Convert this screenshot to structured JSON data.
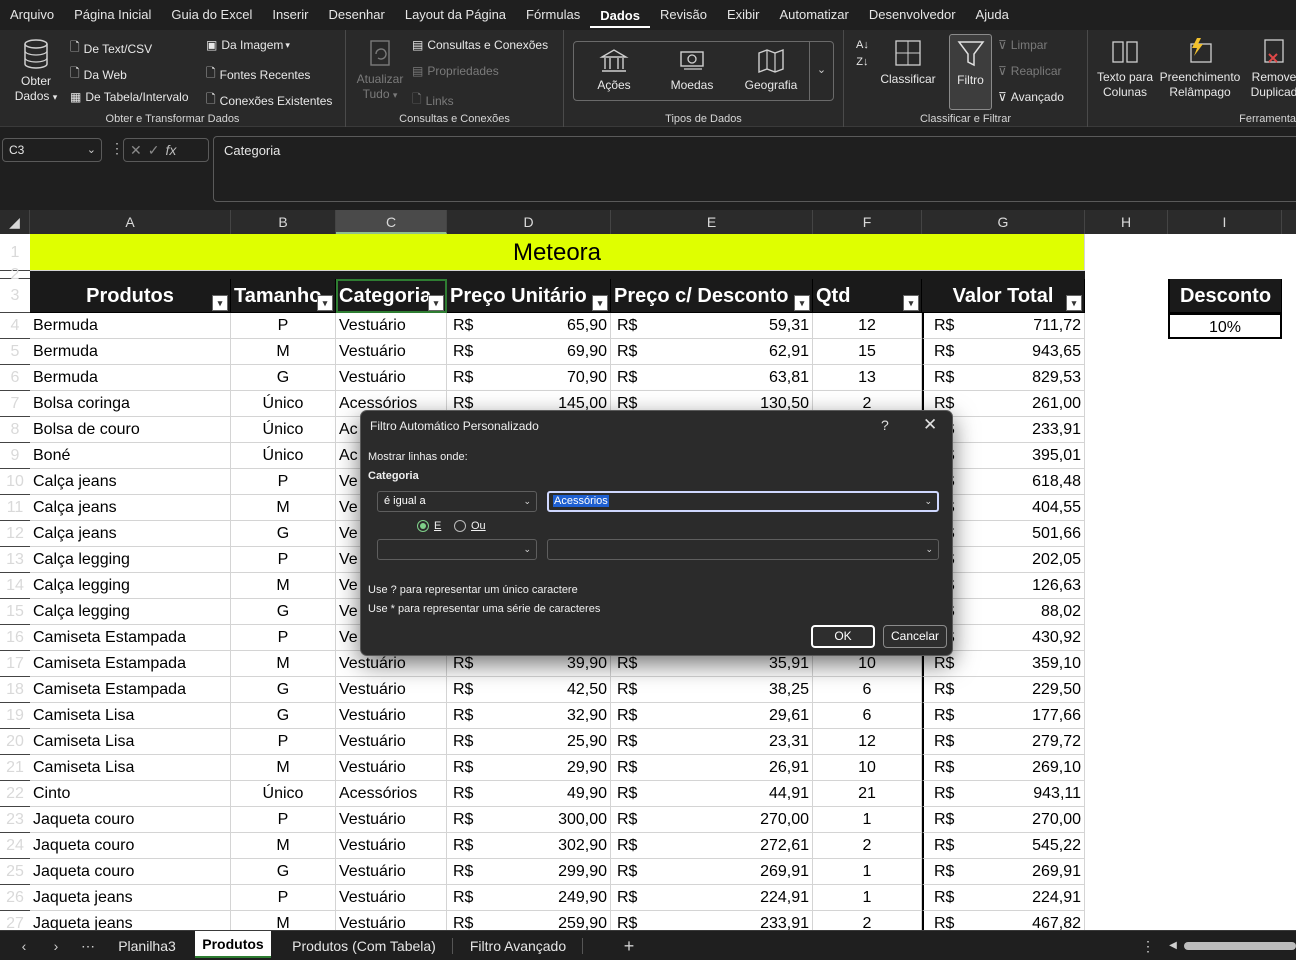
{
  "menu": [
    "Arquivo",
    "Página Inicial",
    "Guia do Excel",
    "Inserir",
    "Desenhar",
    "Layout da Página",
    "Fórmulas",
    "Dados",
    "Revisão",
    "Exibir",
    "Automatizar",
    "Desenvolvedor",
    "Ajuda"
  ],
  "active_menu": "Dados",
  "ribbon": {
    "obter": {
      "big_label_1": "Obter",
      "big_label_2": "Dados",
      "items": [
        "De Text/CSV",
        "Da Web",
        "De Tabela/Intervalo",
        "Da Imagem",
        "Fontes Recentes",
        "Conexões Existentes"
      ],
      "group_label": "Obter e Transformar Dados"
    },
    "consultas": {
      "big_label_1": "Atualizar",
      "big_label_2": "Tudo",
      "items": [
        "Consultas e Conexões",
        "Propriedades",
        "Links"
      ],
      "group_label": "Consultas e Conexões"
    },
    "tipos": {
      "items": [
        "Ações",
        "Moedas",
        "Geografia"
      ],
      "group_label": "Tipos de Dados"
    },
    "classificar": {
      "classificar_label": "Classificar",
      "filtro_label": "Filtro",
      "items": [
        "Limpar",
        "Reaplicar",
        "Avançado"
      ],
      "group_label": "Classificar e Filtrar"
    },
    "ferramentas": {
      "texto_1": "Texto para",
      "texto_2": "Colunas",
      "preench_1": "Preenchimento",
      "preench_2": "Relâmpago",
      "remove_1": "Remove",
      "remove_2": "Duplicad",
      "group_label": "Ferramenta"
    }
  },
  "formula_bar": {
    "name_box": "C3",
    "fx": "fx",
    "content": "Categoria"
  },
  "columns": [
    "A",
    "B",
    "C",
    "D",
    "E",
    "F",
    "G",
    "H",
    "I"
  ],
  "sheet": {
    "title": "Meteora",
    "headers": [
      "Produtos",
      "Tamanho",
      "Categoria",
      "Preço Unitário",
      "Preço c/ Desconto",
      "Qtd",
      "Valor Total"
    ],
    "desconto_label": "Desconto",
    "desconto_value": "10%",
    "currency": "R$",
    "rows": [
      {
        "n": "4",
        "a": "Bermuda",
        "b": "P",
        "c": "Vestuário",
        "d": "65,90",
        "e": "59,31",
        "f": "12",
        "g": "711,72"
      },
      {
        "n": "5",
        "a": "Bermuda",
        "b": "M",
        "c": "Vestuário",
        "d": "69,90",
        "e": "62,91",
        "f": "15",
        "g": "943,65"
      },
      {
        "n": "6",
        "a": "Bermuda",
        "b": "G",
        "c": "Vestuário",
        "d": "70,90",
        "e": "63,81",
        "f": "13",
        "g": "829,53"
      },
      {
        "n": "7",
        "a": "Bolsa coringa",
        "b": "Único",
        "c": "Acessórios",
        "d": "145,00",
        "e": "130,50",
        "f": "2",
        "g": "261,00"
      },
      {
        "n": "8",
        "a": "Bolsa de couro",
        "b": "Único",
        "c": "Ac",
        "d": "",
        "e": "",
        "f": "",
        "g": "233,91"
      },
      {
        "n": "9",
        "a": "Boné",
        "b": "Único",
        "c": "Ac",
        "d": "",
        "e": "",
        "f": "",
        "g": "395,01"
      },
      {
        "n": "10",
        "a": "Calça jeans",
        "b": "P",
        "c": "Ve",
        "d": "",
        "e": "",
        "f": "",
        "g": "618,48"
      },
      {
        "n": "11",
        "a": "Calça jeans",
        "b": "M",
        "c": "Ve",
        "d": "",
        "e": "",
        "f": "",
        "g": "404,55"
      },
      {
        "n": "12",
        "a": "Calça jeans",
        "b": "G",
        "c": "Ve",
        "d": "",
        "e": "",
        "f": "",
        "g": "501,66"
      },
      {
        "n": "13",
        "a": "Calça legging",
        "b": "P",
        "c": "Ve",
        "d": "",
        "e": "",
        "f": "",
        "g": "202,05"
      },
      {
        "n": "14",
        "a": "Calça legging",
        "b": "M",
        "c": "Ve",
        "d": "",
        "e": "",
        "f": "",
        "g": "126,63"
      },
      {
        "n": "15",
        "a": "Calça legging",
        "b": "G",
        "c": "Ve",
        "d": "",
        "e": "",
        "f": "",
        "g": "88,02"
      },
      {
        "n": "16",
        "a": "Camiseta Estampada",
        "b": "P",
        "c": "Ve",
        "d": "",
        "e": "",
        "f": "",
        "g": "430,92"
      },
      {
        "n": "17",
        "a": "Camiseta Estampada",
        "b": "M",
        "c": "Vestuário",
        "d": "39,90",
        "e": "35,91",
        "f": "10",
        "g": "359,10"
      },
      {
        "n": "18",
        "a": "Camiseta Estampada",
        "b": "G",
        "c": "Vestuário",
        "d": "42,50",
        "e": "38,25",
        "f": "6",
        "g": "229,50"
      },
      {
        "n": "19",
        "a": "Camiseta Lisa",
        "b": "G",
        "c": "Vestuário",
        "d": "32,90",
        "e": "29,61",
        "f": "6",
        "g": "177,66"
      },
      {
        "n": "20",
        "a": "Camiseta Lisa",
        "b": "P",
        "c": "Vestuário",
        "d": "25,90",
        "e": "23,31",
        "f": "12",
        "g": "279,72"
      },
      {
        "n": "21",
        "a": "Camiseta Lisa",
        "b": "M",
        "c": "Vestuário",
        "d": "29,90",
        "e": "26,91",
        "f": "10",
        "g": "269,10"
      },
      {
        "n": "22",
        "a": "Cinto",
        "b": "Único",
        "c": "Acessórios",
        "d": "49,90",
        "e": "44,91",
        "f": "21",
        "g": "943,11"
      },
      {
        "n": "23",
        "a": "Jaqueta couro",
        "b": "P",
        "c": "Vestuário",
        "d": "300,00",
        "e": "270,00",
        "f": "1",
        "g": "270,00"
      },
      {
        "n": "24",
        "a": "Jaqueta couro",
        "b": "M",
        "c": "Vestuário",
        "d": "302,90",
        "e": "272,61",
        "f": "2",
        "g": "545,22"
      },
      {
        "n": "25",
        "a": "Jaqueta couro",
        "b": "G",
        "c": "Vestuário",
        "d": "299,90",
        "e": "269,91",
        "f": "1",
        "g": "269,91"
      },
      {
        "n": "26",
        "a": "Jaqueta jeans",
        "b": "P",
        "c": "Vestuário",
        "d": "249,90",
        "e": "224,91",
        "f": "1",
        "g": "224,91"
      },
      {
        "n": "27",
        "a": "Jaqueta jeans",
        "b": "M",
        "c": "Vestuário",
        "d": "259,90",
        "e": "233,91",
        "f": "2",
        "g": "467,82"
      }
    ]
  },
  "dialog": {
    "title": "Filtro Automático Personalizado",
    "help": "?",
    "close": "✕",
    "show_rows": "Mostrar linhas onde:",
    "field": "Categoria",
    "operator1": "é igual a",
    "value1": "Acessórios",
    "and_label": "E",
    "or_label": "Ou",
    "operator2": "",
    "value2": "",
    "hint1": "Use ? para representar um único caractere",
    "hint2": "Use * para representar uma série de caracteres",
    "ok": "OK",
    "cancel": "Cancelar"
  },
  "tabs": [
    "Planilha3",
    "Produtos",
    "Produtos (Com Tabela)",
    "Filtro Avançado"
  ],
  "active_tab": "Produtos",
  "colors": {
    "title_bg": "#dfff00",
    "header_bg": "#1a1a1a",
    "accent_green": "#7fd08a",
    "selection_blue": "#1e5fd1"
  }
}
